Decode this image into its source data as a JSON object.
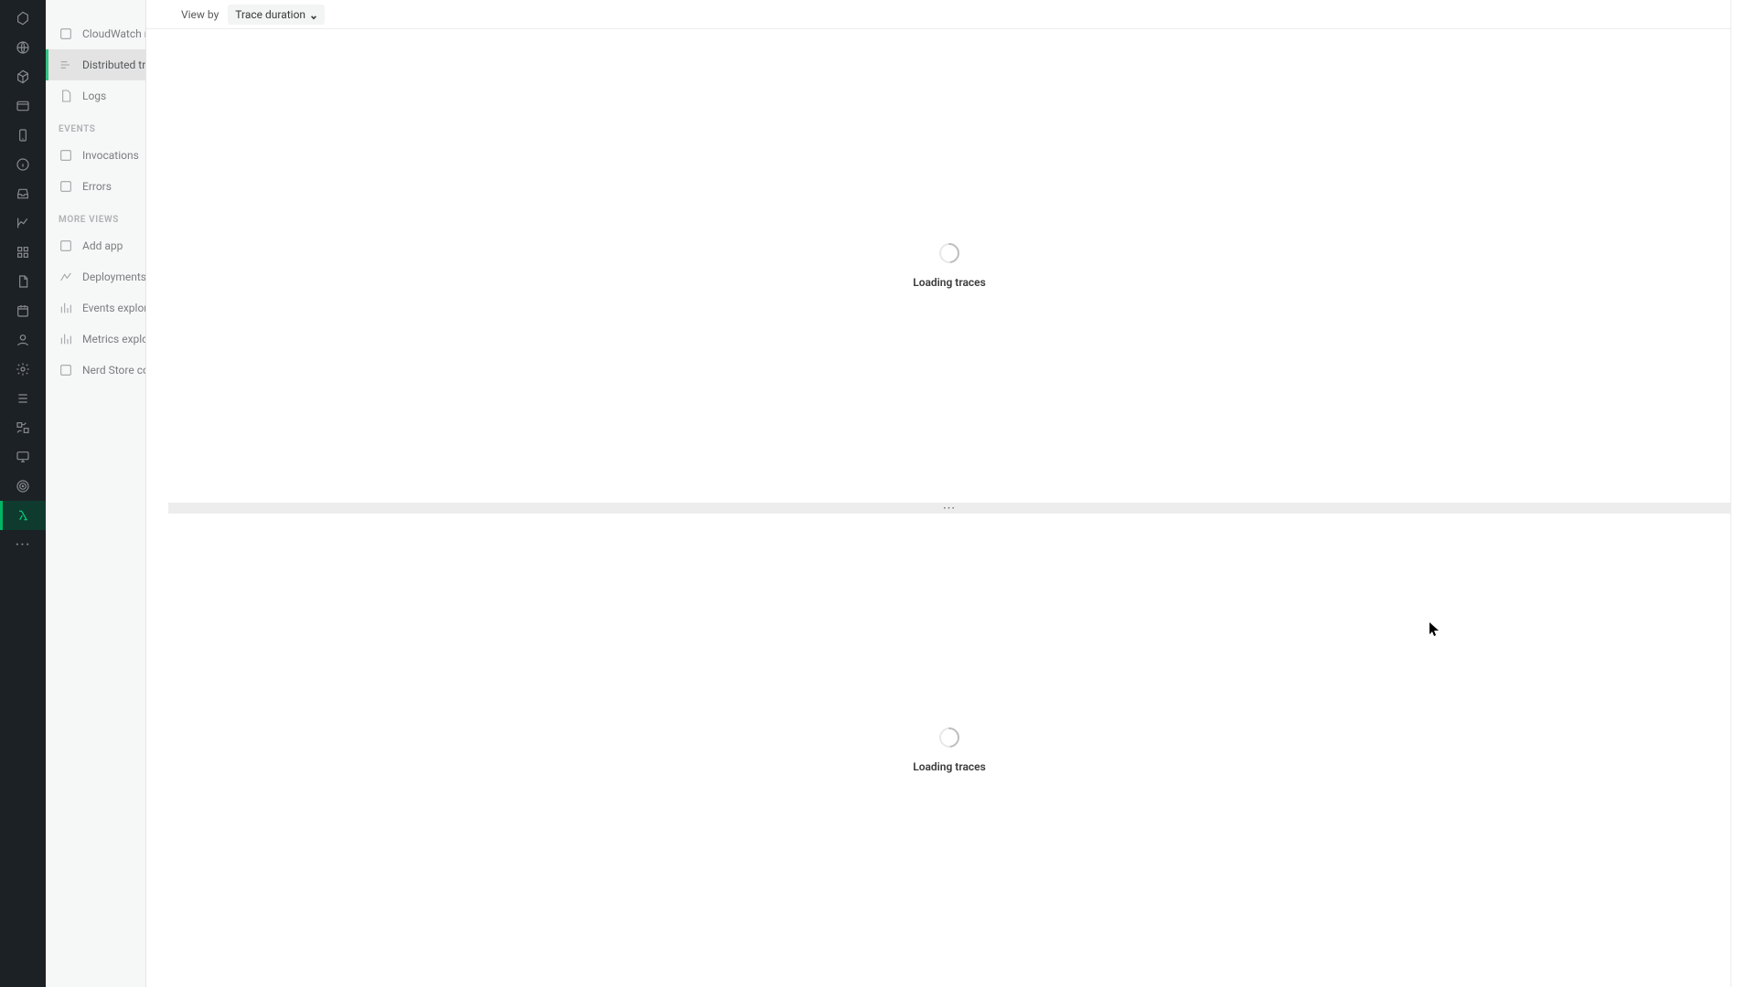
{
  "toolbar": {
    "view_by_label": "View by",
    "dropdown_value": "Trace duration"
  },
  "side": {
    "items_top": [
      {
        "label": "CloudWatch metric streams"
      },
      {
        "label": "Distributed tracing"
      },
      {
        "label": "Logs"
      }
    ],
    "section_events": "EVENTS",
    "items_events": [
      {
        "label": "Invocations"
      },
      {
        "label": "Errors"
      }
    ],
    "section_more": "MORE VIEWS",
    "items_more": [
      {
        "label": "Add app"
      },
      {
        "label": "Deployments"
      },
      {
        "label": "Events explorer"
      },
      {
        "label": "Metrics explorer"
      },
      {
        "label": "Nerd Store collection browser"
      }
    ]
  },
  "loading_text": "Loading traces",
  "splitter_glyph": "⋯"
}
